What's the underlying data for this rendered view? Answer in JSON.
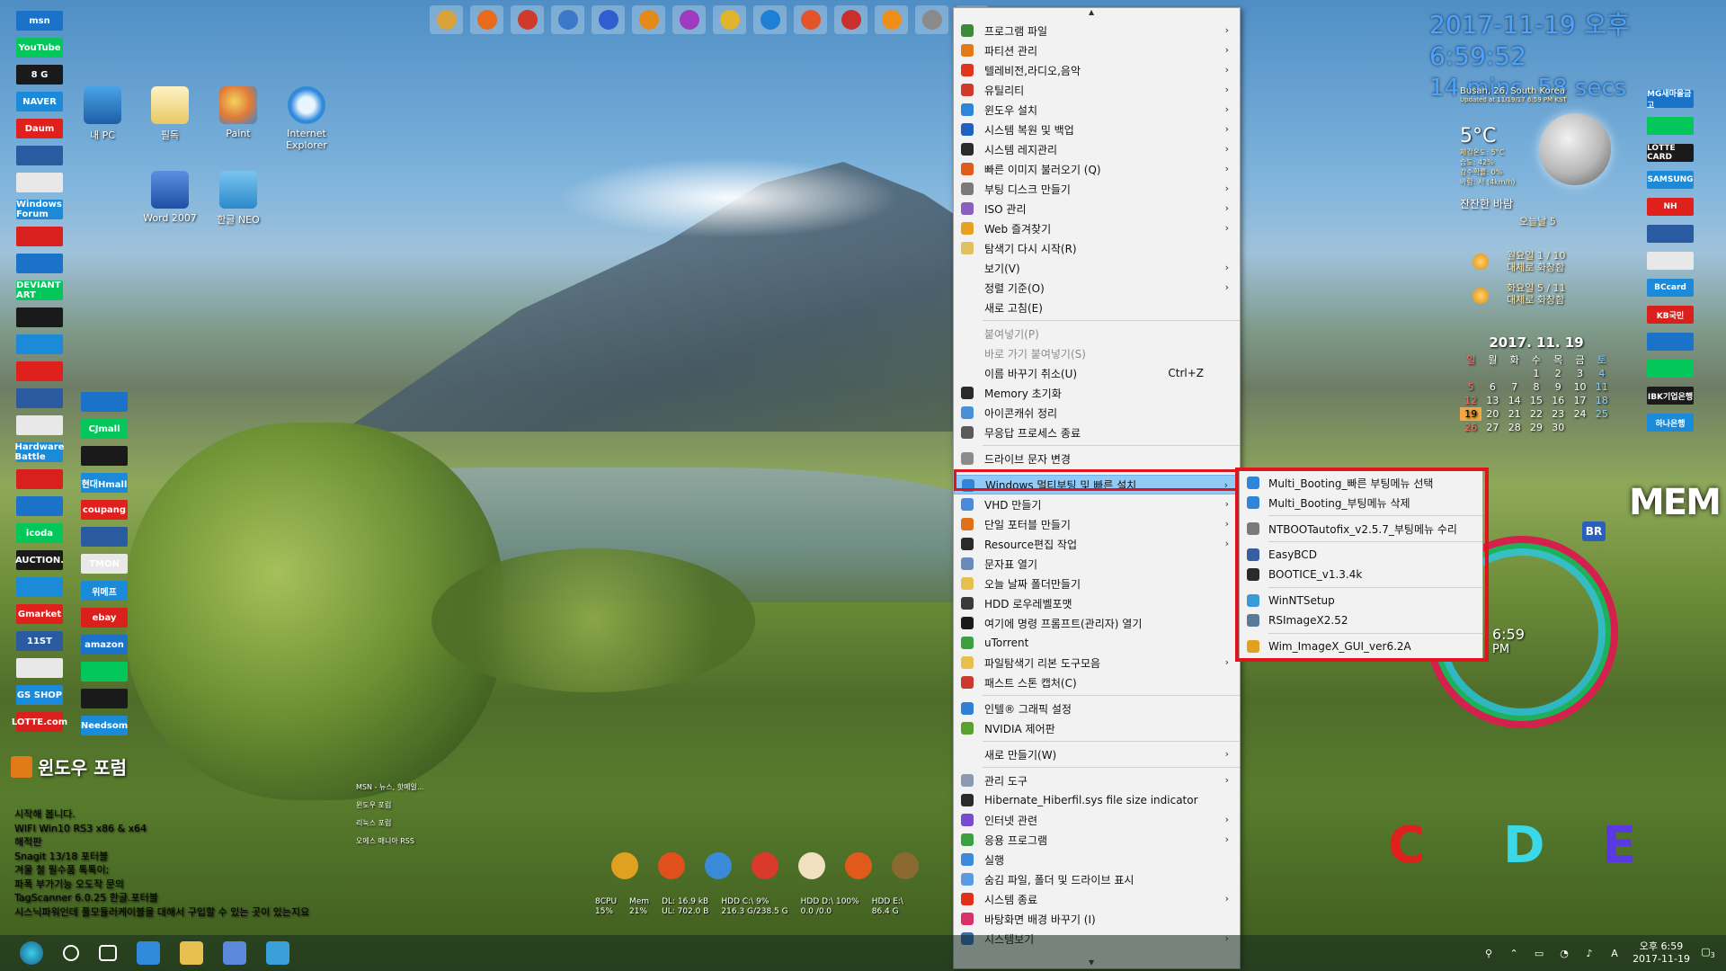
{
  "desktop": {
    "icons": [
      {
        "label": "내 PC"
      },
      {
        "label": "필독"
      },
      {
        "label": "Paint"
      },
      {
        "label": "Internet Explorer"
      },
      {
        "label": "Word 2007"
      },
      {
        "label": "한글 NEO"
      }
    ],
    "left_logos_col1": [
      "msn",
      "YouTube",
      "8 G",
      "NAVER",
      "Daum",
      "",
      "",
      "Windows Forum",
      "",
      "",
      "DEVIANT ART",
      "",
      "",
      "",
      "",
      "",
      "Hardware Battle",
      "",
      "",
      "icoda",
      "AUCTION.",
      "",
      "Gmarket",
      "11ST",
      "",
      "GS SHOP",
      "LOTTE.com"
    ],
    "left_logos_col2": [
      "",
      "CJmall",
      "",
      "현대Hmall",
      "coupang",
      "",
      "TMON",
      "위메프",
      "ebay",
      "amazon",
      "",
      "",
      "Needsom"
    ],
    "right_logos": [
      "MG새마을금고",
      "",
      "LOTTE CARD",
      "SAMSUNG",
      "NH",
      "",
      "",
      "BCcard",
      "KB국민",
      "",
      "",
      "IBK기업은행",
      "하나은행"
    ],
    "forum": {
      "title": "윈도우 포럼",
      "lines": [
        "시작해 봅니다.",
        "WIFI Win10 RS3 x86 & x64",
        "해적판",
        "Snagit 13/18 포터블",
        "겨울 철 필수품 톡톡이;",
        "파폭 부가기능 오도작 문의",
        "TagScanner 6.0.25 한글.포터블",
        "시스닉파워인데 풀모듈러케이블을 대해서 구입할 수 있는 곳이 있는지요"
      ],
      "mini_links": [
        "MSN - 뉴스, 핫메일...",
        "윈도우 포럼",
        "리눅스 포럼",
        "오에스 매니아 RSS"
      ]
    }
  },
  "topbar_icon_colors": [
    "#d9a23a",
    "#e86b1c",
    "#d03a2c",
    "#3b78c8",
    "#2f5fcf",
    "#e28b1a",
    "#9e3bbf",
    "#e0b42c",
    "#1d7fd6",
    "#e5532a",
    "#c9302c",
    "#ef8f1a",
    "#8a8a8a",
    "#5b9bd5"
  ],
  "clock_widget": {
    "line1": "2017-11-19 오후 6:59:52",
    "line2": "14 mins, 58 secs"
  },
  "weather": {
    "city": "Busan, 26, South Korea",
    "updated": "Updated at 11/19/17 6:59 PM KST",
    "temp": "5°C",
    "details": [
      "체감온도: 5°C",
      "습도: 42%",
      "강수확률: 0%",
      "바람: 서 (4km/h)"
    ],
    "condition": "잔잔한 바람",
    "today_label": "오늘날 5",
    "forecast": [
      {
        "day": "월요일 1 / 10",
        "desc": "대체로 화창함"
      },
      {
        "day": "화요일 5 / 11",
        "desc": "대체로 화창함"
      }
    ]
  },
  "calendar": {
    "title": "2017. 11. 19",
    "headers": [
      "일",
      "월",
      "화",
      "수",
      "목",
      "금",
      "토"
    ],
    "rows": [
      [
        "",
        "",
        "",
        "1",
        "2",
        "3",
        "4"
      ],
      [
        "5",
        "6",
        "7",
        "8",
        "9",
        "10",
        "11"
      ],
      [
        "12",
        "13",
        "14",
        "15",
        "16",
        "17",
        "18"
      ],
      [
        "19",
        "20",
        "21",
        "22",
        "23",
        "24",
        "25"
      ],
      [
        "26",
        "27",
        "28",
        "29",
        "30",
        "",
        ""
      ]
    ]
  },
  "gadget": {
    "mem_label": "MEM",
    "time": "6:59",
    "ampm": "PM",
    "drives": [
      "C",
      "D",
      "E"
    ],
    "badge": "BR"
  },
  "stats": [
    {
      "l1": "8CPU",
      "l2": "15%"
    },
    {
      "l1": "Mem",
      "l2": "21%"
    },
    {
      "l1": "DL: 16.9 kB",
      "l2": "UL: 702.0 B"
    },
    {
      "l1": "HDD C:\\ 9%",
      "l2": "216.3 G/238.5 G"
    },
    {
      "l1": "HDD D:\\ 100%",
      "l2": "0.0 /0.0"
    },
    {
      "l1": "HDD E:\\",
      "l2": "86.4 G"
    }
  ],
  "context_menu": {
    "items": [
      {
        "label": "프로그램 파일",
        "arrow": true,
        "color": "#3a8a3a"
      },
      {
        "label": "파티션 관리",
        "arrow": true,
        "color": "#e07b18"
      },
      {
        "label": "텔레비전,라디오,음악",
        "arrow": true,
        "color": "#e0351c"
      },
      {
        "label": "유틸리티",
        "arrow": true,
        "color": "#d03a2c"
      },
      {
        "label": "윈도우 설치",
        "arrow": true,
        "color": "#2f86d6"
      },
      {
        "label": "시스템 복원 및 백업",
        "arrow": true,
        "color": "#1f5fbf"
      },
      {
        "label": "시스템 레지관리",
        "arrow": true,
        "color": "#2a2a2a"
      },
      {
        "label": "빠른 이미지 불러오기 (Q)",
        "arrow": true,
        "color": "#e05a1c"
      },
      {
        "label": "부팅 디스크 만들기",
        "arrow": true,
        "color": "#7a7a7a"
      },
      {
        "label": "ISO 관리",
        "arrow": true,
        "color": "#8a5fbf"
      },
      {
        "label": "Web 즐겨찾기",
        "arrow": true,
        "color": "#e8a020"
      },
      {
        "label": "탐색기 다시 시작(R)",
        "arrow": false,
        "color": "#e0c060"
      },
      {
        "label": "보기(V)",
        "arrow": true,
        "color": ""
      },
      {
        "label": "정렬 기준(O)",
        "arrow": true,
        "color": ""
      },
      {
        "label": "새로 고침(E)",
        "arrow": false,
        "color": ""
      },
      {
        "sep": true
      },
      {
        "label": "붙여넣기(P)",
        "disabled": true,
        "color": ""
      },
      {
        "label": "바로 가기 붙여넣기(S)",
        "disabled": true,
        "color": ""
      },
      {
        "label": "이름 바꾸기 취소(U)",
        "shortcut": "Ctrl+Z",
        "color": ""
      },
      {
        "label": "Memory 초기화",
        "color": "#2a2a2a"
      },
      {
        "label": "아이콘캐쉬 정리",
        "color": "#4a90d9"
      },
      {
        "label": "무응답 프로세스 종료",
        "color": "#5a5a5a"
      },
      {
        "sep": true
      },
      {
        "label": "드라이브 문자 변경",
        "color": "#8a8a8a"
      },
      {
        "sep": true
      },
      {
        "label": "Windows 멀티부팅 및 빠른 설치",
        "arrow": true,
        "color": "#2f86d6",
        "highlight": true
      },
      {
        "label": "VHD 만들기",
        "arrow": true,
        "color": "#4a8ad9"
      },
      {
        "label": "단일 포터블 만들기",
        "arrow": true,
        "color": "#e0701c"
      },
      {
        "label": "Resource편집 작업",
        "arrow": true,
        "color": "#2a2a2a"
      },
      {
        "label": "문자표 열기",
        "color": "#6a8ab9"
      },
      {
        "label": "오늘 날짜 폴더만들기",
        "color": "#e8c050"
      },
      {
        "label": "HDD 로우레벨포맷",
        "color": "#3a3a3a"
      },
      {
        "label": "여기에 명령 프롬프트(관리자) 열기",
        "color": "#1a1a1a"
      },
      {
        "label": "uTorrent",
        "color": "#3aa040"
      },
      {
        "label": "파일탐색기 리본 도구모음",
        "arrow": true,
        "color": "#e8c050"
      },
      {
        "label": "패스트 스톤 캡처(C)",
        "color": "#c93a2c"
      },
      {
        "sep": true
      },
      {
        "label": "인텔® 그래픽 설정",
        "color": "#2f7fd6"
      },
      {
        "label": "NVIDIA 제어판",
        "color": "#5aa02c"
      },
      {
        "sep": true
      },
      {
        "label": "새로 만들기(W)",
        "arrow": true,
        "color": ""
      },
      {
        "sep": true
      },
      {
        "label": "관리 도구",
        "arrow": true,
        "color": "#8a9ab0"
      },
      {
        "label": "Hibernate_Hiberfil.sys file size indicator",
        "color": "#2a2a2a"
      },
      {
        "label": "인터넷 관련",
        "arrow": true,
        "color": "#7a4ad0"
      },
      {
        "label": "응용 프로그램",
        "arrow": true,
        "color": "#3aa040"
      },
      {
        "label": "실행",
        "color": "#3a8ad9"
      },
      {
        "label": "숨김 파일, 폴더 및 드라이브 표시",
        "color": "#5a9ae0"
      },
      {
        "label": "시스템 종료",
        "arrow": true,
        "color": "#e0301c"
      },
      {
        "label": "바탕화면 배경 바꾸기 (I)",
        "color": "#d9306a"
      },
      {
        "label": "시스템보기",
        "arrow": true,
        "color": "#2f6fbf"
      }
    ],
    "submenu": [
      {
        "label": "Multi_Booting_빠른 부팅메뉴 선택",
        "color": "#2f86d6"
      },
      {
        "label": "Multi_Booting_부팅메뉴 삭제",
        "color": "#2f86d6"
      },
      {
        "sep": true
      },
      {
        "label": "NTBOOTautofix_v2.5.7_부팅메뉴 수리",
        "color": "#7a7a7a"
      },
      {
        "sep": true
      },
      {
        "label": "EasyBCD",
        "color": "#3a5fa0"
      },
      {
        "label": "BOOTICE_v1.3.4k",
        "color": "#2a2a2a"
      },
      {
        "sep": true
      },
      {
        "label": "WinNTSetup",
        "color": "#3a9ad9"
      },
      {
        "label": "RSImageX2.52",
        "color": "#5a7a9a"
      },
      {
        "sep": true
      },
      {
        "label": "Wim_ImageX_GUI_ver6.2A",
        "color": "#e0a020"
      }
    ]
  },
  "taskbar": {
    "clock_time": "오후 6:59",
    "clock_date": "2017-11-19",
    "lang": "A",
    "notification_count": "3"
  }
}
